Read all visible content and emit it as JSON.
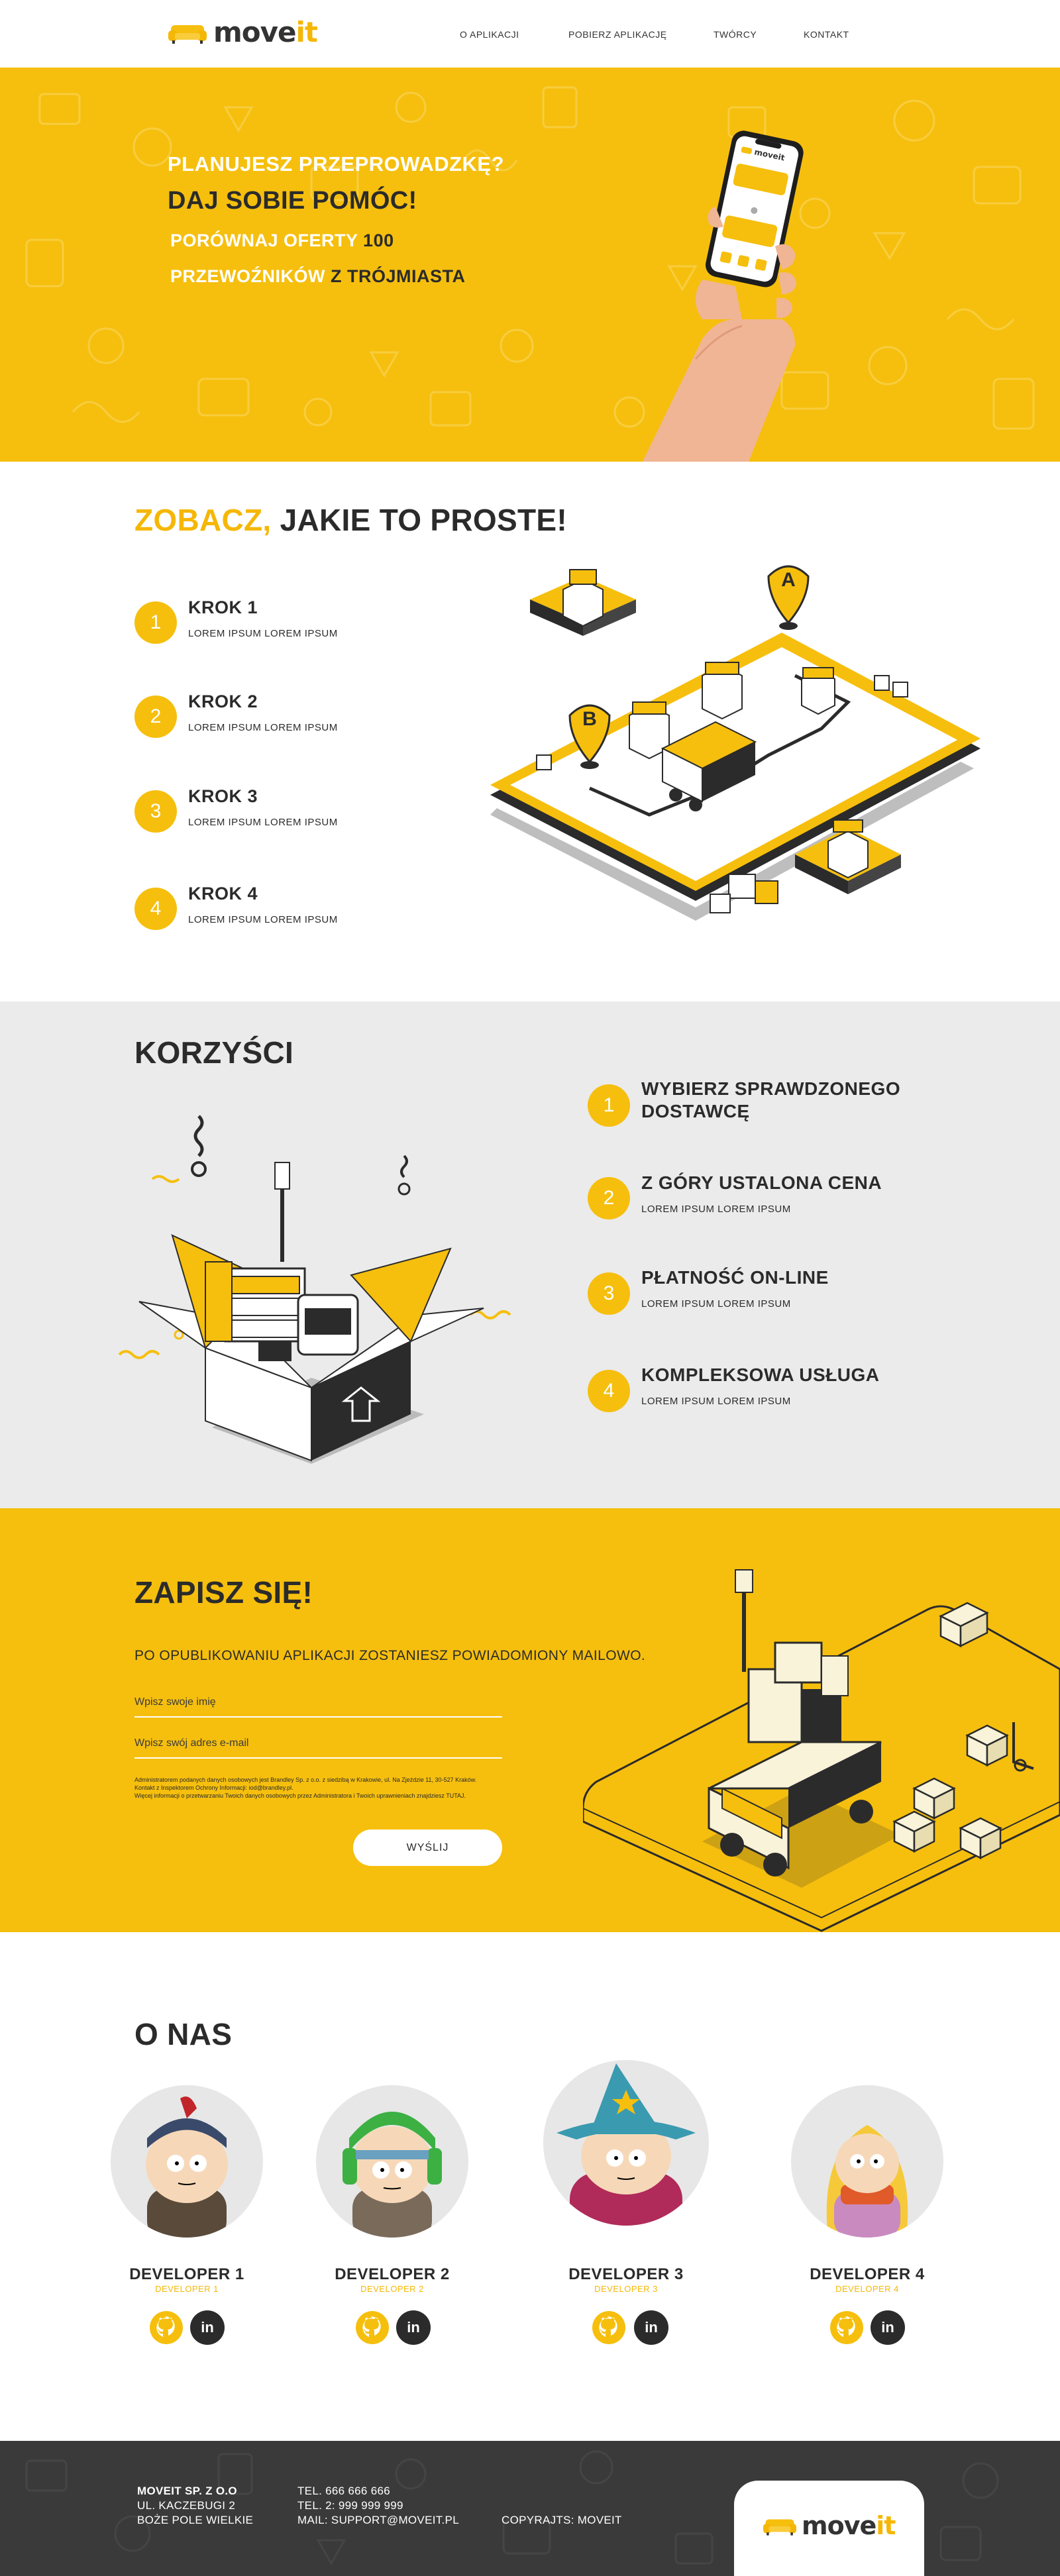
{
  "header": {
    "logo_main": "move",
    "logo_accent": "it",
    "nav": [
      {
        "label": "O APLIKACJI"
      },
      {
        "label": "POBIERZ APLIKACJĘ"
      },
      {
        "label": "TWÓRCY"
      },
      {
        "label": "KONTAKT"
      }
    ]
  },
  "hero": {
    "line1": "PLANUJESZ PRZEPROWADZKĘ?",
    "line2": "DAJ SOBIE POMÓC!",
    "line3_a": "PORÓWNAJ OFERTY",
    "line3_b": "100",
    "line4_a": "PRZEWOŹNIKÓW",
    "line4_b": "Z TRÓJMIASTA",
    "phone_logo": "moveit"
  },
  "steps": {
    "title_accent": "ZOBACZ,",
    "title_rest": "JAKIE TO PROSTE!",
    "items": [
      {
        "num": "1",
        "title": "KROK 1",
        "sub": "LOREM IPSUM LOREM IPSUM"
      },
      {
        "num": "2",
        "title": "KROK 2",
        "sub": "LOREM IPSUM LOREM IPSUM"
      },
      {
        "num": "3",
        "title": "KROK 3",
        "sub": "LOREM IPSUM LOREM IPSUM"
      },
      {
        "num": "4",
        "title": "KROK 4",
        "sub": "LOREM IPSUM LOREM IPSUM"
      }
    ],
    "pin_a": "A",
    "pin_b": "B"
  },
  "benefits": {
    "title": "KORZYŚCI",
    "items": [
      {
        "num": "1",
        "title_l1": "WYBIERZ SPRAWDZONEGO",
        "title_l2": "DOSTAWCĘ",
        "sub": ""
      },
      {
        "num": "2",
        "title_l1": "Z GÓRY USTALONA CENA",
        "title_l2": "",
        "sub": "LOREM IPSUM LOREM IPSUM"
      },
      {
        "num": "3",
        "title_l1": "PŁATNOŚĆ ON-LINE",
        "title_l2": "",
        "sub": "LOREM IPSUM LOREM IPSUM"
      },
      {
        "num": "4",
        "title_l1": "KOMPLEKSOWA USŁUGA",
        "title_l2": "",
        "sub": "LOREM IPSUM LOREM IPSUM"
      }
    ]
  },
  "signup": {
    "title": "ZAPISZ SIĘ!",
    "text": "PO OPUBLIKOWANIU APLIKACJI ZOSTANIESZ POWIADOMIONY MAILOWO.",
    "name_placeholder": "Wpisz swoje imię",
    "email_placeholder": "Wpisz swój adres e-mail",
    "consent_l1": "Administratorem podanych danych osobowych jest Brandley Sp. z o.o. z siedzibą w Krakowie, ul. Na Zjeździe 11, 30-527 Kraków.",
    "consent_l2": "Kontakt z Inspektorem Ochrony Informacji: iod@brandley.pl.",
    "consent_l3": "Więcej informacji o przetwarzaniu Twoich danych osobowych przez Administratora i Twoich uprawnieniach znajdziesz TUTAJ.",
    "button": "WYŚLIJ"
  },
  "team": {
    "title": "O NAS",
    "devs": [
      {
        "name": "DEVELOPER 1",
        "role": "DEVELOPER 1"
      },
      {
        "name": "DEVELOPER 2",
        "role": "DEVELOPER 2"
      },
      {
        "name": "DEVELOPER 3",
        "role": "DEVELOPER 3"
      },
      {
        "name": "DEVELOPER 4",
        "role": "DEVELOPER 4"
      }
    ],
    "linkedin_glyph": "in"
  },
  "footer": {
    "company": "MOVEIT SP. Z O.O",
    "street": "UL. KACZEBUGI 2",
    "city": "BOŻE POLE WIELKIE",
    "tel1": "TEL. 666 666 666",
    "tel2": "TEL. 2: 999 999 999",
    "mail": "MAIL: SUPPORT@MOVEIT.PL",
    "copyright": "COPYRAJTS: MOVEIT",
    "logo_main": "move",
    "logo_accent": "it"
  },
  "colors": {
    "brand_yellow": "#f6bf0e",
    "dark": "#2b2b2b",
    "light_gray": "#ebebeb",
    "footer": "#3a3a3a"
  }
}
